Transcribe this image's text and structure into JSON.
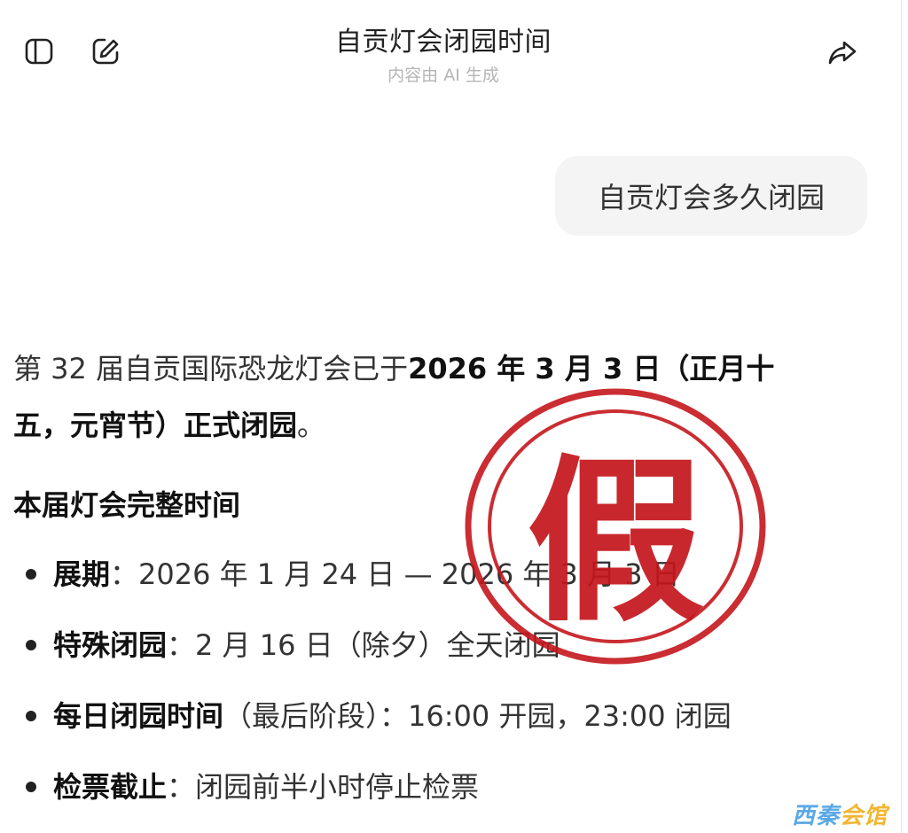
{
  "header": {
    "title": "自贡灯会闭园时间",
    "subtitle": "内容由 AI 生成",
    "icons": {
      "sidebar": "sidebar-icon",
      "new_chat": "edit-icon",
      "share": "share-icon"
    }
  },
  "user_message": "自贡灯会多久闭园",
  "answer": {
    "intro_plain": "第 32 届自贡国际恐龙灯会已于",
    "intro_bold": "2026 年 3 月 3 日（正月十五，元宵节）正式闭园",
    "intro_end": "。",
    "heading": "本届灯会完整时间",
    "items": [
      {
        "label": "展期",
        "text": "：2026 年 1 月 24 日 — 2026 年 3 月 3 日"
      },
      {
        "label": "特殊闭园",
        "text": "：2 月 16 日（除夕）全天闭园"
      },
      {
        "label": "每日闭园时间",
        "text": "（最后阶段）：16:00 开园，23:00 闭园"
      },
      {
        "label": "检票截止",
        "text": "：闭园前半小时停止检票"
      }
    ]
  },
  "stamp": {
    "text": "假",
    "color": "#c4161c"
  },
  "watermark": {
    "part1": "西秦",
    "part2": "会馆"
  }
}
